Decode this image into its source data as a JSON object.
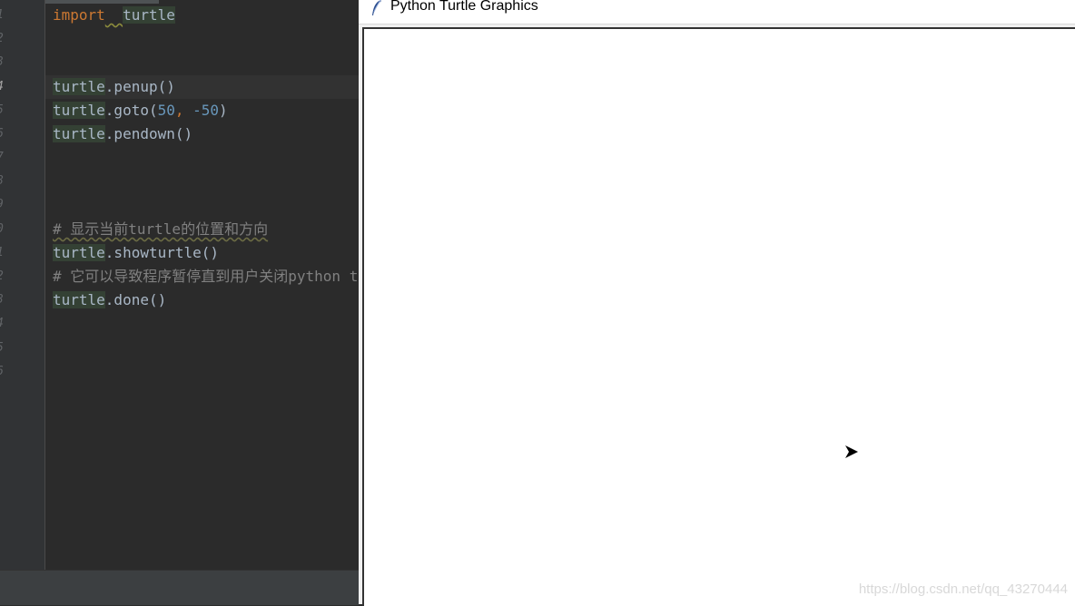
{
  "editor": {
    "line_numbers": [
      "1",
      "2",
      "3",
      "4",
      "5",
      "6",
      "7",
      "8",
      "9",
      "0",
      "1",
      "2",
      "3",
      "4",
      "5",
      "6"
    ],
    "lines": [
      {
        "kw": "import",
        "ident": "turtle"
      },
      {},
      {},
      {
        "ident": "turtle",
        "rest": ".penup()"
      },
      {
        "ident": "turtle",
        "pre": ".goto(",
        "num1": "50",
        "sep": ", ",
        "num2": "-50",
        "post": ")"
      },
      {
        "ident": "turtle",
        "rest": ".pendown()"
      },
      {},
      {},
      {},
      {
        "comment": "# 显示当前turtle的位置和方向"
      },
      {
        "ident": "turtle",
        "rest": ".showturtle()"
      },
      {
        "comment": "# 它可以导致程序暂停直到用户关闭python t"
      },
      {
        "ident": "turtle",
        "rest": ".done()"
      }
    ]
  },
  "turtle_window": {
    "title": "Python Turtle Graphics",
    "icons": {
      "title": "feather-icon",
      "turtle": "arrow-cursor-icon"
    }
  },
  "watermark": "https://blog.csdn.net/qq_43270444",
  "colors": {
    "editor_bg": "#2b2b2b",
    "keyword": "#cc7832",
    "number": "#6897bb",
    "comment": "#808080",
    "canvas_bg": "#ffffff"
  }
}
